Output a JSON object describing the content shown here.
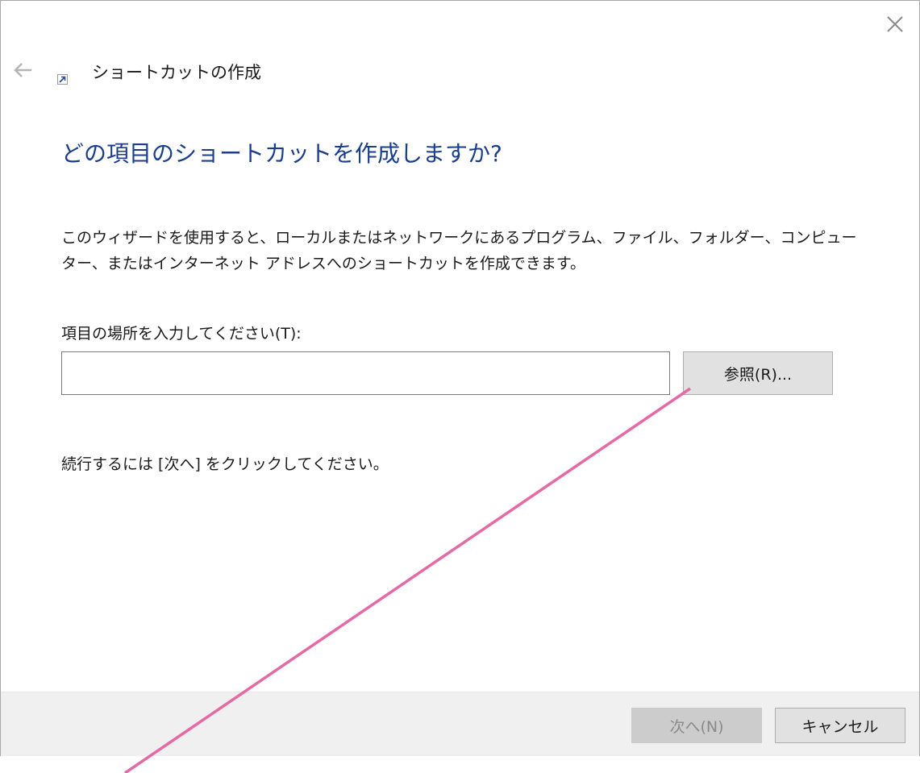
{
  "window": {
    "title": "ショートカットの作成",
    "icons": {
      "close": "close-icon",
      "back": "back-arrow-icon",
      "app": "shortcut-icon"
    }
  },
  "wizard": {
    "heading": "どの項目のショートカットを作成しますか?",
    "description": "このウィザードを使用すると、ローカルまたはネットワークにあるプログラム、ファイル、フォルダー、コンピューター、またはインターネット アドレスへのショートカットを作成できます。",
    "location_label": "項目の場所を入力してください(T):",
    "location_value": "",
    "browse_label": "参照(R)...",
    "continue_text": "続行するには [次へ] をクリックしてください。"
  },
  "footer": {
    "next_label": "次へ(N)",
    "cancel_label": "キャンセル"
  },
  "colors": {
    "heading": "#1a3e8c",
    "annotation_line": "#e46aa6",
    "footer_bg": "#f0f0f0"
  }
}
